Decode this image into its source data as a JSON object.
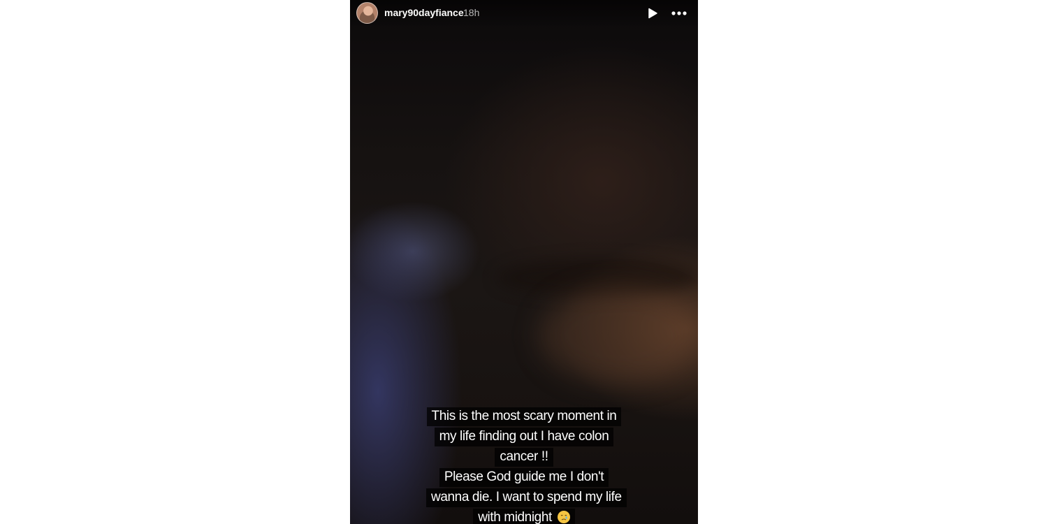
{
  "story": {
    "username": "mary90dayfiance",
    "time_ago": "18h",
    "caption_1": "This is the most scary moment in my life finding out I have colon cancer !!",
    "caption_2": "Please God guide me I don't wanna die. I want to spend my life with midnight",
    "caption_2_emoji": "crying-face-emoji",
    "icons": {
      "avatar": "profile-avatar",
      "play": "play-icon",
      "more": "more-options-icon"
    },
    "colors": {
      "background_page": "#ffffff",
      "story_dark": "#161211",
      "caption_bg": "#000000",
      "text": "#ffffff",
      "emoji": "#f5c542"
    }
  }
}
